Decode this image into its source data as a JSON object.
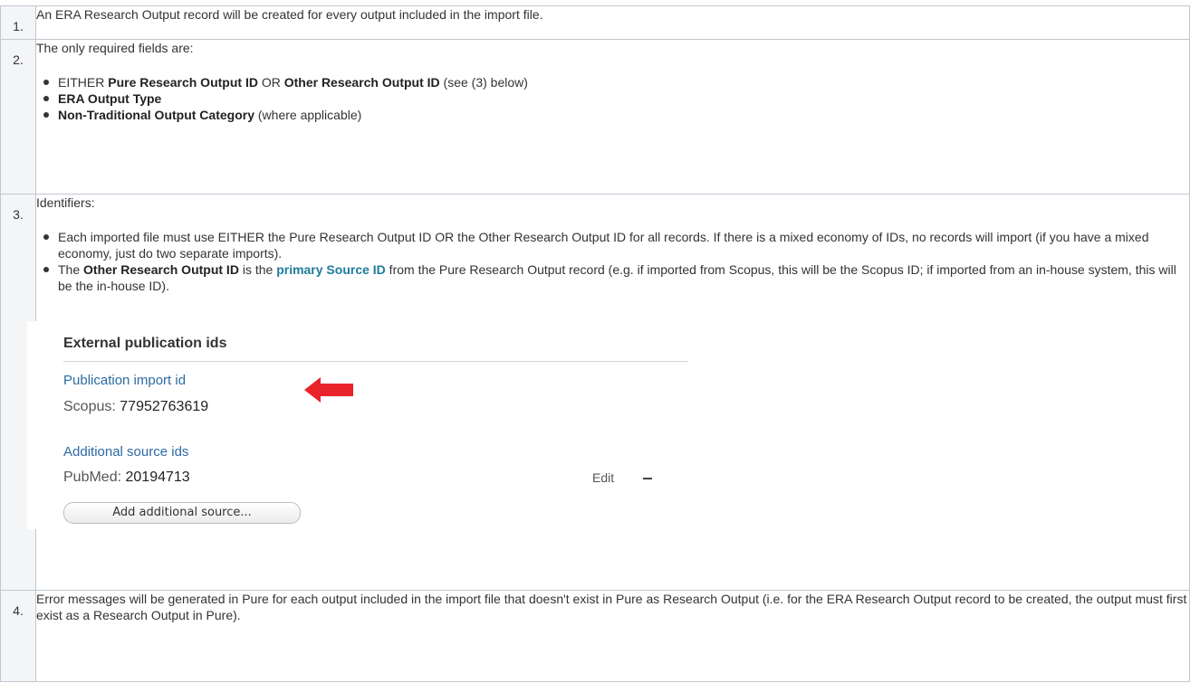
{
  "rows": [
    {
      "num": "1.",
      "text": "An ERA Research Output record will be created for every output included in the import file."
    },
    {
      "num": "2.",
      "intro": "The only required fields are:",
      "b1": {
        "pre": "EITHER ",
        "bold1": "Pure Research Output ID",
        "mid": " OR ",
        "bold2": "Other Research Output ID",
        "post": " (see (3) below)"
      },
      "b2": {
        "bold": "ERA Output Type"
      },
      "b3": {
        "bold": "Non-Traditional Output Category",
        "post": " (where applicable)"
      }
    },
    {
      "num": "3.",
      "intro": "Identifiers:",
      "b1": "Each imported file must use EITHER the Pure Research Output ID OR the Other Research Output ID for all records.  If there is a mixed economy of IDs, no records will import (if you have a mixed economy, just do two separate imports).",
      "b2": {
        "pre": "The ",
        "bold": "Other Research Output ID",
        "mid": " is the ",
        "link": "primary Source ID",
        "post": " from the Pure Research Output record (e.g. if imported from Scopus, this will be the Scopus ID; if imported from an in-house system, this will be the in-house ID)."
      }
    },
    {
      "num": "4.",
      "text": "Error messages will be generated in Pure for each output included in the import file that doesn't exist in Pure as Research Output (i.e. for the ERA Research Output record to be created, the output must first exist as a Research Output in Pure)."
    }
  ],
  "screenshot": {
    "title": "External publication ids",
    "import_label": "Publication import id",
    "import_source": "Scopus:",
    "import_value": "77952763619",
    "additional_label": "Additional source ids",
    "additional_source": "PubMed:",
    "additional_value": "20194713",
    "edit_label": "Edit",
    "add_button": "Add additional source...",
    "arrow_color": "#e8242a",
    "arrow_icon": "arrow-left-icon"
  }
}
